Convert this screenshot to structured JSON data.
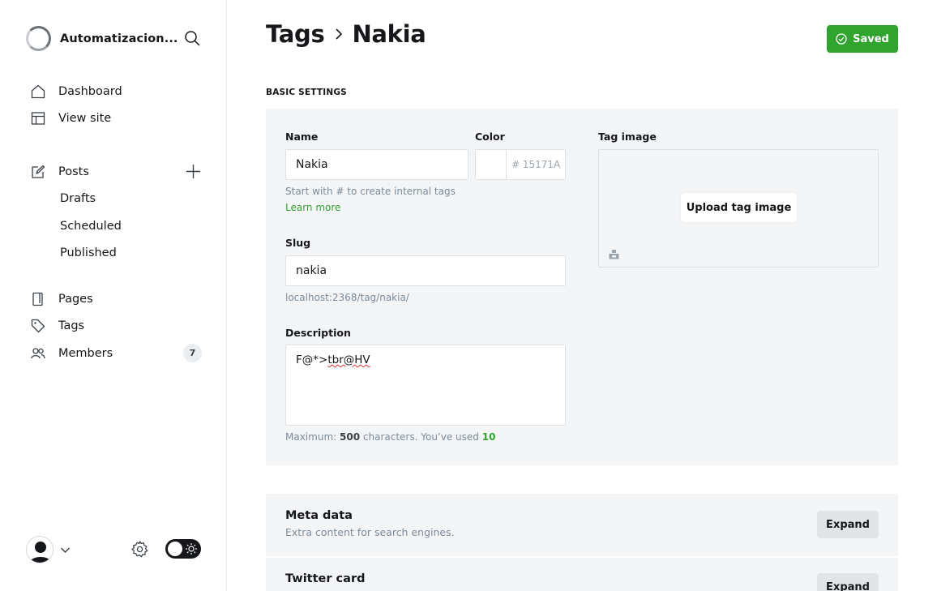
{
  "sidebar": {
    "site_name": "Automatizacion...",
    "nav": {
      "dashboard": "Dashboard",
      "view_site": "View site",
      "posts": "Posts",
      "drafts": "Drafts",
      "scheduled": "Scheduled",
      "published": "Published",
      "pages": "Pages",
      "tags": "Tags",
      "members": "Members"
    },
    "members_count": "7"
  },
  "header": {
    "breadcrumb_parent": "Tags",
    "breadcrumb_current": "Nakia",
    "saved_label": "Saved"
  },
  "basic_settings": {
    "section_title": "BASIC SETTINGS",
    "name_label": "Name",
    "name_value": "Nakia",
    "name_hint": "Start with # to create internal tags",
    "learn_more": "Learn more",
    "color_label": "Color",
    "color_hex_placeholder": "# 15171A",
    "slug_label": "Slug",
    "slug_value": "nakia",
    "slug_url": "localhost:2368/tag/nakia/",
    "description_label": "Description",
    "description_prefix": "F@*>",
    "description_flagged": "tbr@HV",
    "desc_hint_prefix": "Maximum:",
    "desc_hint_max": "500",
    "desc_hint_mid": "characters. You’ve used",
    "desc_hint_used": "10",
    "tag_image_label": "Tag image",
    "upload_label": "Upload tag image"
  },
  "meta_card": {
    "title": "Meta data",
    "subtitle": "Extra content for search engines.",
    "expand": "Expand"
  },
  "twitter_card": {
    "title": "Twitter card",
    "expand": "Expand"
  },
  "colors": {
    "accent_green": "#30a42f",
    "text_dark": "#15171a",
    "panel_bg": "#f4f5f6"
  }
}
